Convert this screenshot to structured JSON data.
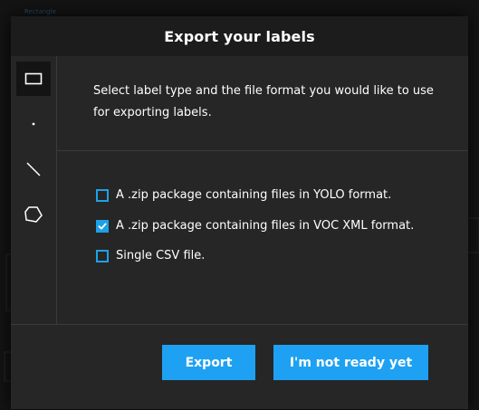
{
  "background": {
    "label": "Rectangle"
  },
  "modal": {
    "title": "Export your labels",
    "description": "Select label type and the file format you would like to use for exporting labels.",
    "tools": [
      {
        "icon": "rectangle-icon",
        "active": true
      },
      {
        "icon": "point-icon",
        "active": false
      },
      {
        "icon": "line-icon",
        "active": false
      },
      {
        "icon": "polygon-icon",
        "active": false
      }
    ],
    "options": [
      {
        "label": "A .zip package containing files in YOLO format.",
        "checked": false
      },
      {
        "label": "A .zip package containing files in VOC XML format.",
        "checked": true
      },
      {
        "label": "Single CSV file.",
        "checked": false
      }
    ],
    "buttons": {
      "export": "Export",
      "cancel": "I'm not ready yet"
    }
  },
  "colors": {
    "accent": "#1ea1f2",
    "header": "#1c1c1c",
    "panel": "#262626"
  }
}
